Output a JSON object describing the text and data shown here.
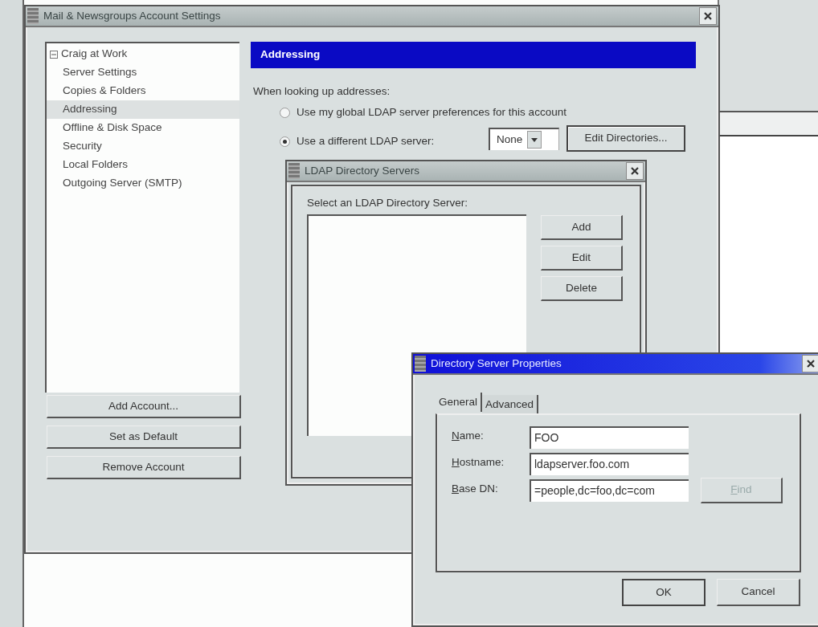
{
  "main_window": {
    "title": "Mail & Newsgroups Account Settings",
    "active": false,
    "accounts": [
      {
        "label": "Craig at Work",
        "expanded": true,
        "selected": false,
        "children": [
          {
            "label": "Server Settings",
            "selected": false
          },
          {
            "label": "Copies & Folders",
            "selected": false
          },
          {
            "label": "Addressing",
            "selected": true
          },
          {
            "label": "Offline & Disk Space",
            "selected": false
          },
          {
            "label": "Security",
            "selected": false
          }
        ]
      },
      {
        "label": "Local Folders",
        "selected": false
      },
      {
        "label": "Outgoing Server (SMTP)",
        "selected": false
      }
    ],
    "account_buttons": [
      "Add Account...",
      "Set as Default",
      "Remove Account"
    ],
    "panel_title": "Addressing",
    "prompt": "When looking up addresses:",
    "options": [
      {
        "label": "Use my global LDAP server preferences for this account",
        "selected": false
      },
      {
        "label": "Use a different LDAP server:",
        "selected": true
      }
    ],
    "server_select": {
      "value": "None"
    },
    "edit_button": "Edit Directories..."
  },
  "ldap_window": {
    "title": "LDAP Directory Servers",
    "active": false,
    "label": "Select an LDAP Directory Server:",
    "buttons": [
      "Add",
      "Edit",
      "Delete"
    ]
  },
  "properties_window": {
    "title": "Directory Server Properties",
    "active": true,
    "tabs": [
      {
        "label": "General",
        "selected": true
      },
      {
        "label": "Advanced",
        "selected": false
      }
    ],
    "fields": [
      {
        "label": "Name:",
        "value": "FOO"
      },
      {
        "label": "Hostname:",
        "value": "ldapserver.foo.com"
      },
      {
        "label": "Base DN:",
        "value": "=people,dc=foo,dc=com"
      }
    ],
    "find_button": {
      "label": "Find",
      "disabled": true
    },
    "buttons": [
      "OK",
      "Cancel"
    ]
  }
}
